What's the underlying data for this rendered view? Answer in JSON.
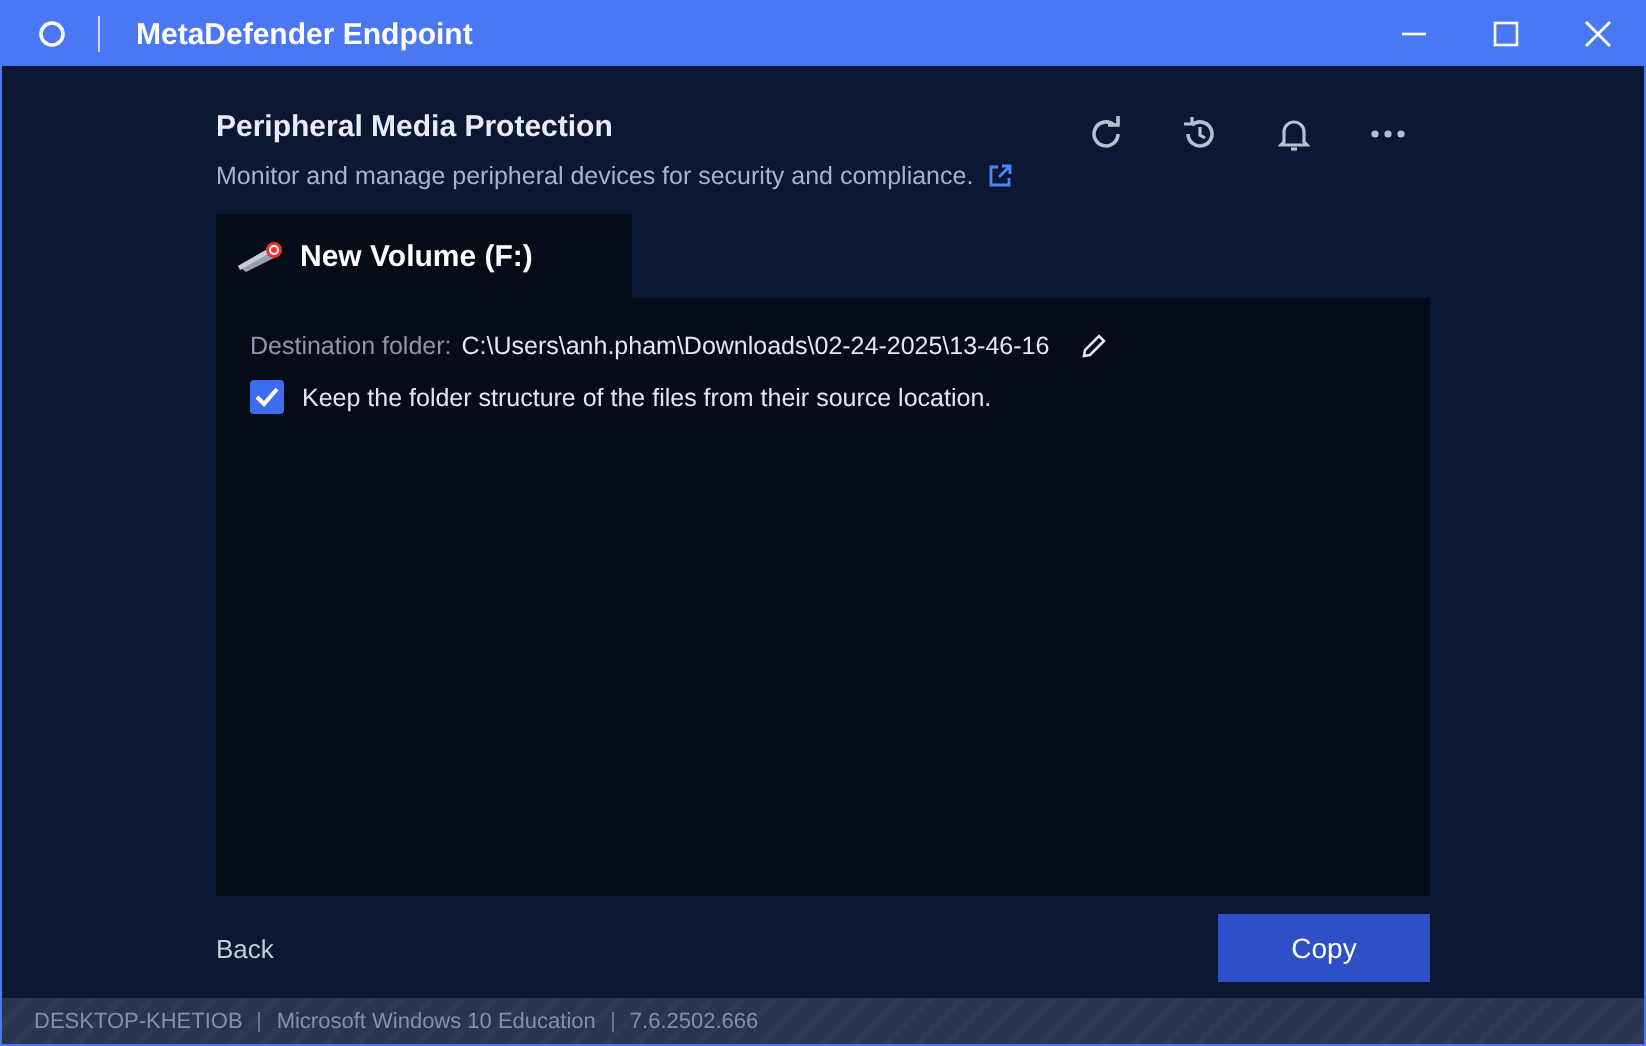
{
  "window": {
    "title": "MetaDefender Endpoint"
  },
  "header": {
    "title": "Peripheral Media Protection",
    "subtitle": "Monitor and manage peripheral devices for security and compliance."
  },
  "tab": {
    "label": "New Volume (F:)",
    "selected": true
  },
  "destination": {
    "label": "Destination folder:",
    "value": "C:\\Users\\anh.pham\\Downloads\\02-24-2025\\13-46-16"
  },
  "keep_structure": {
    "label": "Keep the folder structure of the files from their source location.",
    "checked": true
  },
  "buttons": {
    "back": "Back",
    "copy": "Copy"
  },
  "status_bar": [
    "DESKTOP-KHETIOB",
    "Microsoft Windows 10 Education",
    "7.6.2502.666"
  ]
}
